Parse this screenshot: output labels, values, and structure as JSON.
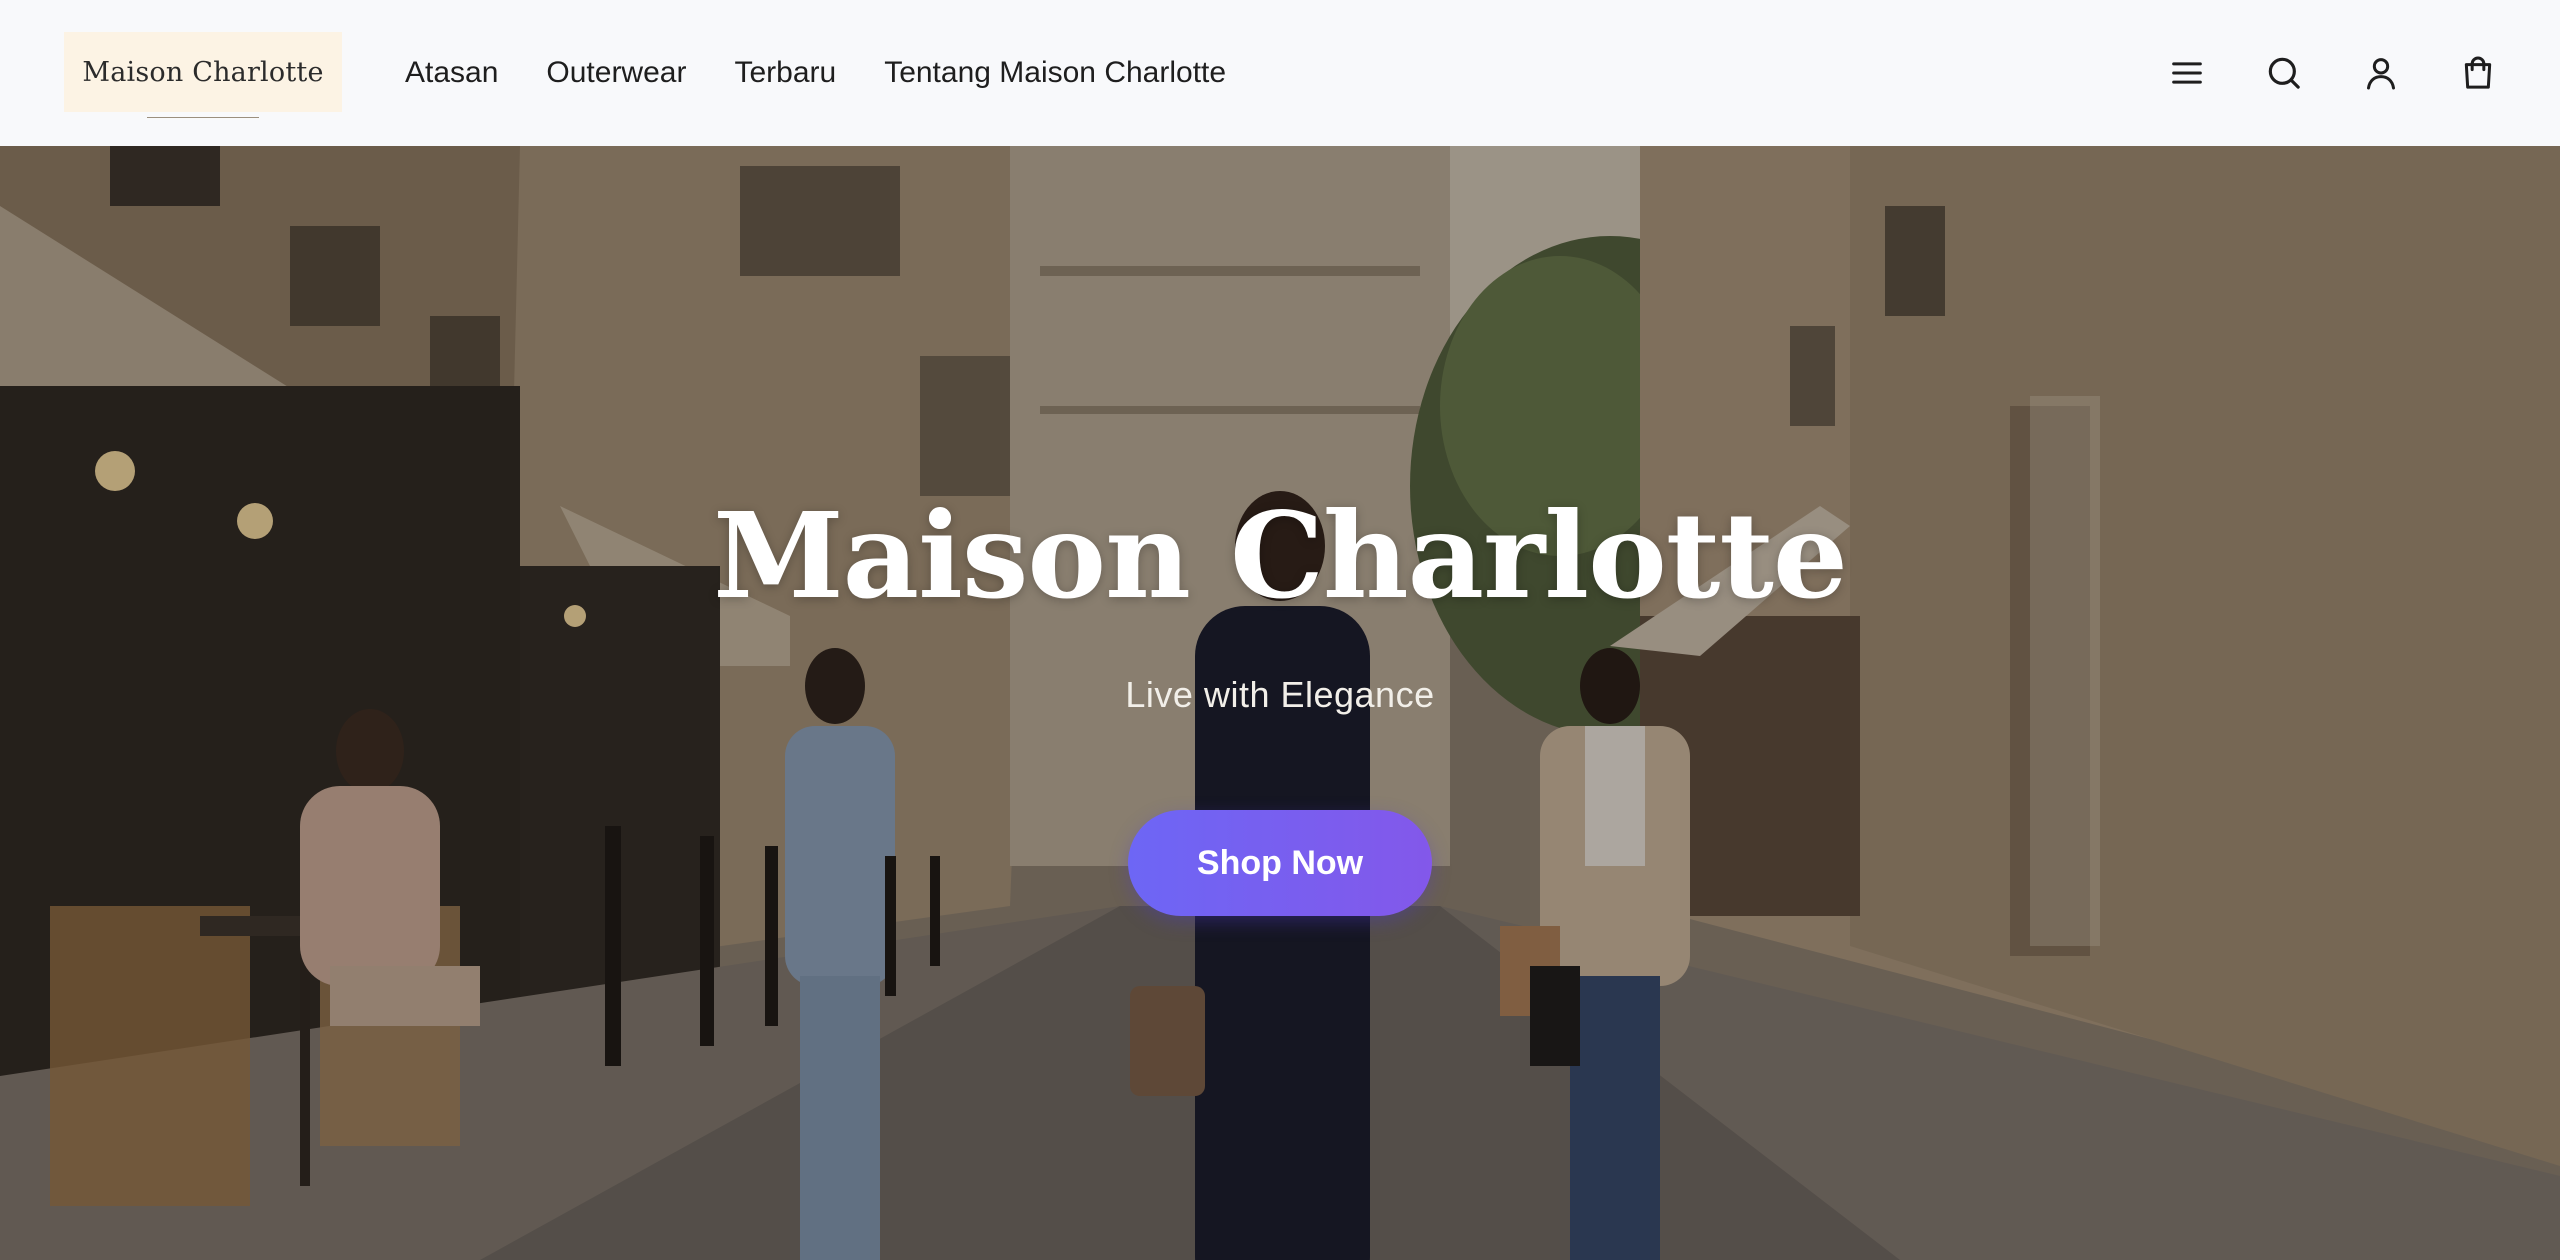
{
  "header": {
    "logo_text": "Maison Charlotte",
    "nav": [
      {
        "label": "Atasan"
      },
      {
        "label": "Outerwear"
      },
      {
        "label": "Terbaru"
      },
      {
        "label": "Tentang Maison Charlotte"
      }
    ],
    "icons": [
      "menu-icon",
      "search-icon",
      "user-icon",
      "shopping-bag-icon"
    ]
  },
  "hero": {
    "title": "Maison Charlotte",
    "subtitle": "Live with Elegance",
    "cta_label": "Shop Now",
    "background": "photo of a Parisian street with women walking and a cafe terrace"
  },
  "colors": {
    "header_bg": "#f8f9fb",
    "logo_bg": "#fcf3e4",
    "cta_start": "#6d66f5",
    "cta_end": "#8358ea",
    "text_dark": "#1e1e1e"
  }
}
